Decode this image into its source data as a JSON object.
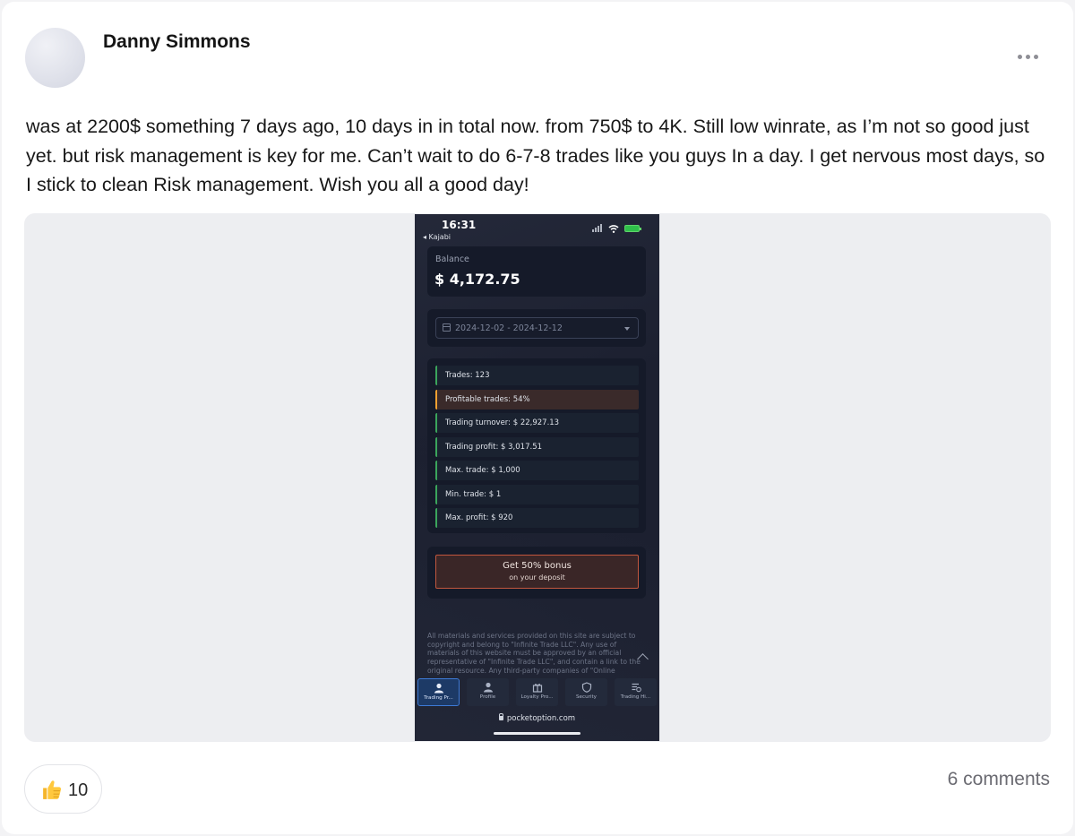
{
  "post": {
    "author": "Danny Simmons",
    "text": "was at 2200$ something 7 days ago, 10 days in in total now. from 750$ to 4K. Still low winrate, as I’m not so good just yet. but risk management is key for me. Can’t wait to do 6-7-8 trades like you guys In a day. I get nervous most days, so I stick to clean Risk management. Wish you all a good day!",
    "likes": "10",
    "comments": "6 comments",
    "more_icon": "more-horizontal-icon",
    "like_icon": "thumbs-up-icon"
  },
  "phone": {
    "time": "16:31",
    "back": "◂ Kajabi",
    "balance_label": "Balance",
    "balance_value": "$ 4,172.75",
    "date_range": "2024-12-02 - 2024-12-12",
    "stats": [
      "Trades: 123",
      "Profitable trades: 54%",
      "Trading turnover: $ 22,927.13",
      "Trading profit: $ 3,017.51",
      "Max. trade: $ 1,000",
      "Min. trade: $ 1",
      "Max. profit: $ 920"
    ],
    "bonus_title": "Get 50% bonus",
    "bonus_sub": "on your deposit",
    "disclaimer": "All materials and services provided on this site are subject to copyright and belong to \"Infinite Trade LLC\". Any use of materials of this website must be approved by an official representative of \"Infinite Trade LLC\", and contain a link to the original resource. Any third-party companies of \"Online",
    "tabs": [
      "Trading Pr...",
      "Profile",
      "Loyalty Pro...",
      "Security",
      "Trading Hi..."
    ],
    "url": "pocketoption.com",
    "colors": {
      "accent_green": "#3ba55c",
      "warn_orange": "#f0a030",
      "bonus_border": "#c2573e",
      "active_tab": "#3d7ad6"
    }
  }
}
